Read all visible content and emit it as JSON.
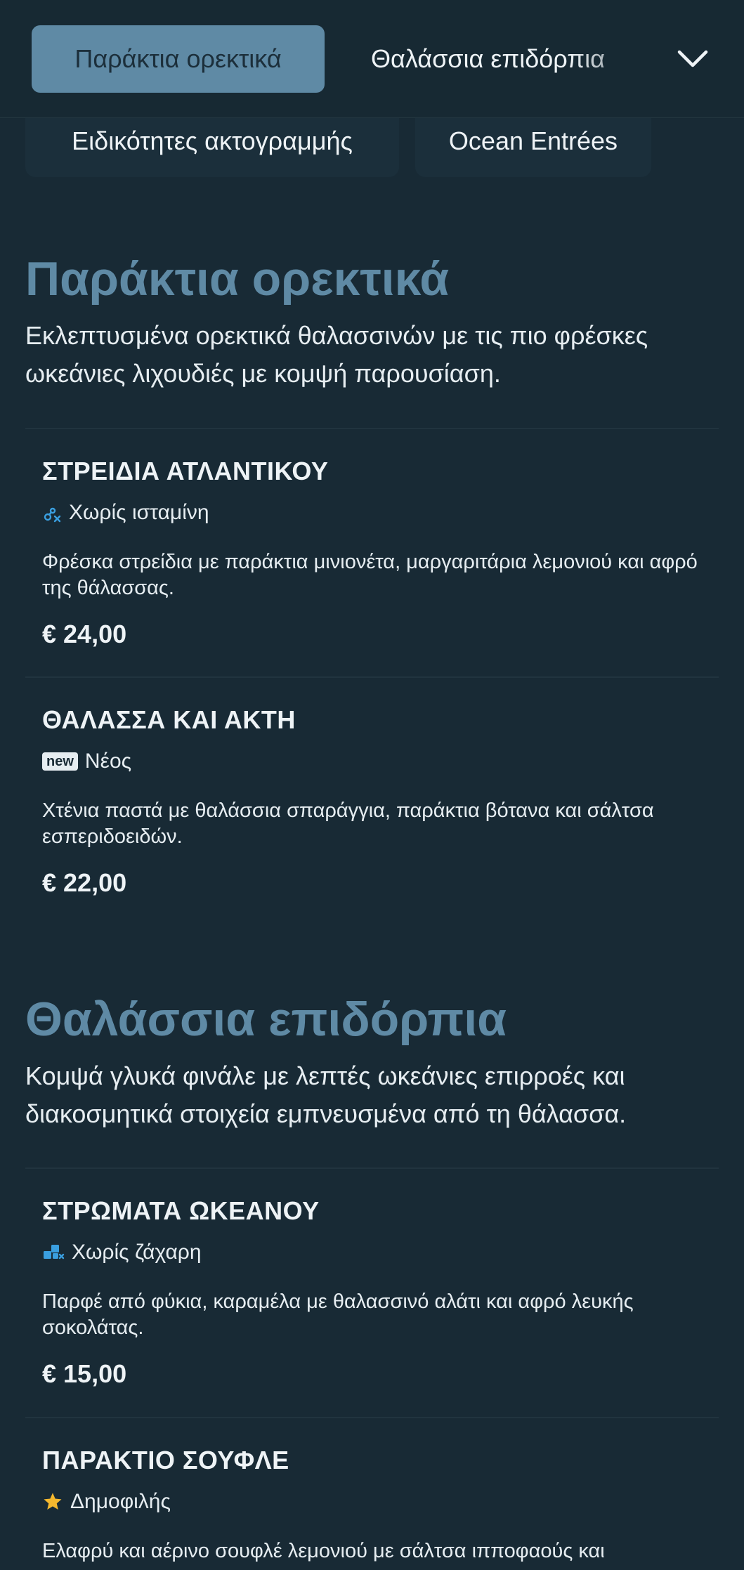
{
  "nav": {
    "active_tab": "Παράκτια ορεκτικά",
    "next_tab": "Θαλάσσια επιδόρπια",
    "chips": [
      "Ειδικότητες ακτογραμμής",
      "Ocean Entrées"
    ]
  },
  "sections": [
    {
      "title": "Παράκτια ορεκτικά",
      "description": "Εκλεπτυσμένα ορεκτικά θαλασσινών με τις πιο φρέσκες ωκεάνιες λιχουδιές με κομψή παρουσίαση.",
      "items": [
        {
          "name": "ΣΤΡΕΙΔΙΑ ΑΤΛΑΝΤΙΚΟΥ",
          "tag": "Χωρίς ισταμίνη",
          "tag_icon": "no-histamine-icon",
          "description": "Φρέσκα στρείδια με παράκτια μινιονέτα, μαργαριτάρια λεμονιού και αφρό της θάλασσας.",
          "price": "€ 24,00"
        },
        {
          "name": "ΘΑΛΑΣΣΑ ΚΑΙ ΑΚΤΗ",
          "tag_badge": "new",
          "tag": "Νέος",
          "tag_icon": "new-badge-icon",
          "description": "Χτένια παστά με θαλάσσια σπαράγγια, παράκτια βότανα και σάλτσα εσπεριδοειδών.",
          "price": "€ 22,00"
        }
      ]
    },
    {
      "title": "Θαλάσσια επιδόρπια",
      "description": "Κομψά γλυκά φινάλε με λεπτές ωκεάνιες επιρροές και διακοσμητικά στοιχεία εμπνευσμένα από τη θάλασσα.",
      "items": [
        {
          "name": "ΣΤΡΩΜΑΤΑ ΩΚΕΑΝΟΥ",
          "tag": "Χωρίς ζάχαρη",
          "tag_icon": "sugar-free-icon",
          "description": "Παρφέ από φύκια, καραμέλα με θαλασσινό αλάτι και αφρό λευκής σοκολάτας.",
          "price": "€ 15,00"
        },
        {
          "name": "ΠΑΡΑΚΤΙΟ ΣΟΥΦΛΕ",
          "tag": "Δημοφιλής",
          "tag_icon": "star-icon",
          "description": "Ελαφρύ και αέρινο σουφλέ λεμονιού με σάλτσα ιπποφαούς και"
        }
      ]
    }
  ],
  "colors": {
    "background": "#182a35",
    "accent": "#5f8aa5",
    "icon_blue": "#3a9fe0",
    "star": "#f5b82e"
  }
}
